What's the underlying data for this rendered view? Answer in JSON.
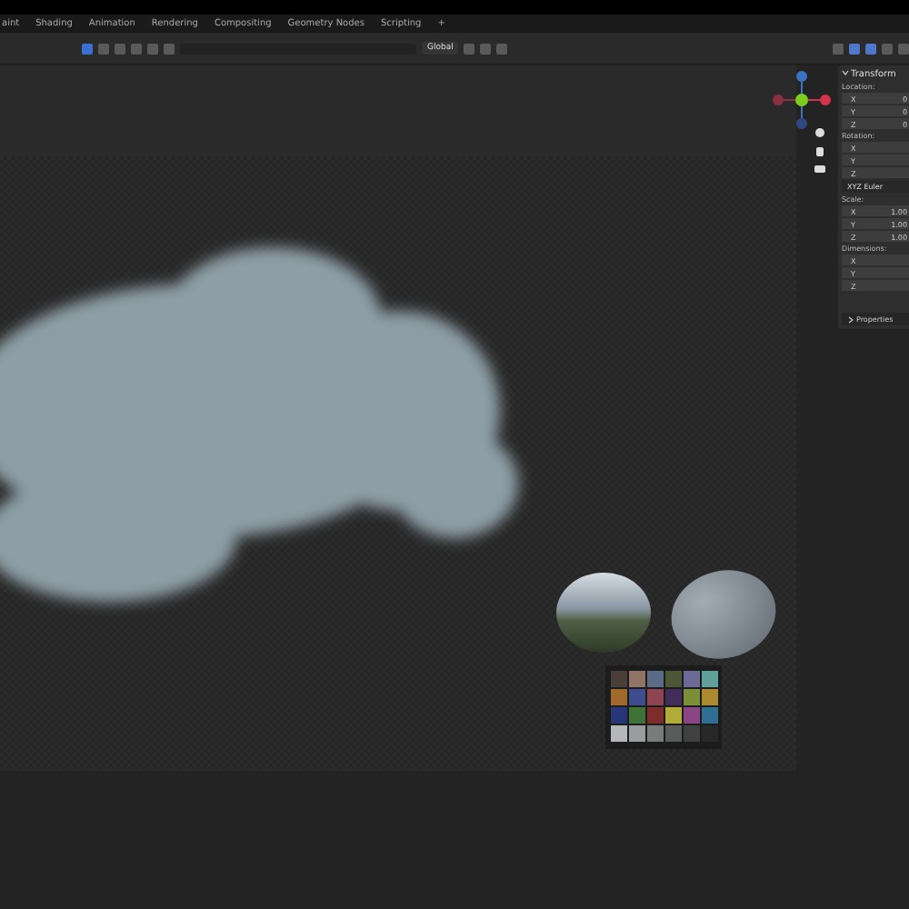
{
  "workspace_tabs": [
    {
      "label": "aint",
      "selected": false
    },
    {
      "label": "Shading",
      "selected": false
    },
    {
      "label": "Animation",
      "selected": false
    },
    {
      "label": "Rendering",
      "selected": false
    },
    {
      "label": "Compositing",
      "selected": false
    },
    {
      "label": "Geometry Nodes",
      "selected": false
    },
    {
      "label": "Scripting",
      "selected": false
    }
  ],
  "add_tab": "+",
  "header": {
    "orientation": "Global"
  },
  "n_panel": {
    "title": "Transform",
    "expanded": true,
    "footer": "Properties",
    "sections": [
      {
        "label": "Location:",
        "rows": [
          {
            "axis": "X",
            "value": "0"
          },
          {
            "axis": "Y",
            "value": "0"
          },
          {
            "axis": "Z",
            "value": "0"
          }
        ]
      },
      {
        "label": "Rotation:",
        "rows": [
          {
            "axis": "X"
          },
          {
            "axis": "Y"
          },
          {
            "axis": "Z"
          }
        ],
        "mode": "XYZ Euler"
      },
      {
        "label": "Scale:",
        "rows": [
          {
            "axis": "X",
            "value": "1.00"
          },
          {
            "axis": "Y",
            "value": "1.00"
          },
          {
            "axis": "Z",
            "value": "1.00"
          }
        ]
      },
      {
        "label": "Dimensions:",
        "rows": [
          {
            "axis": "X"
          },
          {
            "axis": "Y"
          },
          {
            "axis": "Z"
          }
        ]
      }
    ]
  }
}
